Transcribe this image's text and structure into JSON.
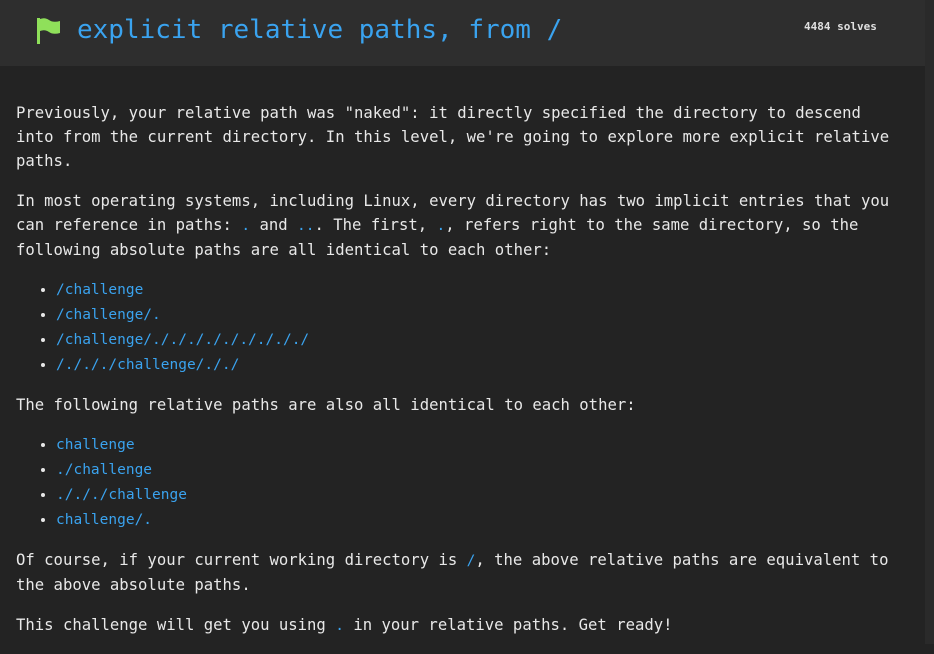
{
  "header": {
    "title": "explicit relative paths, from /",
    "solves": "4484 solves",
    "flag_icon": "flag-icon",
    "flag_color": "#8fe05a",
    "title_color": "#3aa3ef"
  },
  "body": {
    "p1": "Previously, your relative path was \"naked\": it directly specified the directory to descend into from the current directory. In this level, we're going to explore more explicit relative paths.",
    "p2": {
      "a": "In most operating systems, including Linux, every directory has two implicit entries that you can reference in paths: ",
      "code1": ".",
      "b": " and ",
      "code2": "..",
      "c": ". The first, ",
      "code3": ".",
      "d": ", refers right to the same directory, so the following absolute paths are all identical to each other:"
    },
    "absolute_paths": [
      "/challenge",
      "/challenge/.",
      "/challenge/./././././././././",
      "/./././challenge/././"
    ],
    "p3": "The following relative paths are also all identical to each other:",
    "relative_paths": [
      "challenge",
      "./challenge",
      "./././challenge",
      "challenge/."
    ],
    "p4": {
      "a": "Of course, if your current working directory is ",
      "code1": "/",
      "b": ", the above relative paths are equivalent to the above absolute paths."
    },
    "p5": {
      "a": "This challenge will get you using ",
      "code1": ".",
      "b": " in your relative paths. Get ready!"
    }
  }
}
